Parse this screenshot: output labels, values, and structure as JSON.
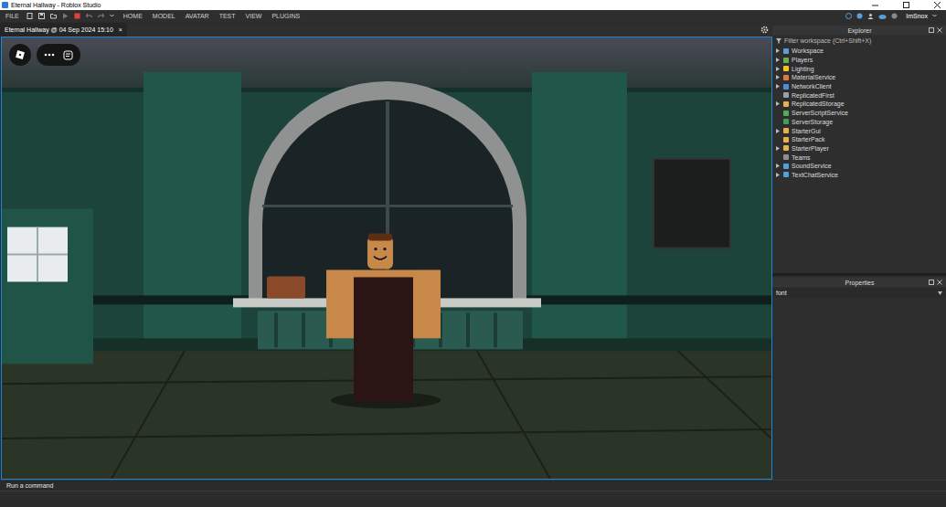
{
  "window": {
    "title": "Eternal Hallway - Roblox Studio"
  },
  "toolbar": {
    "file": "FILE",
    "menus": [
      "HOME",
      "MODEL",
      "AVATAR",
      "TEST",
      "VIEW",
      "PLUGINS"
    ],
    "user": "ImSnox"
  },
  "document_tabs": [
    {
      "label": "Eternal Hallway @ 04 Sep 2024 15:10",
      "close": "×",
      "selected": true
    }
  ],
  "explorer": {
    "title": "Explorer",
    "filter_placeholder": "Filter workspace (Ctrl+Shift+X)",
    "items": [
      {
        "name": "Workspace",
        "expandable": true,
        "color": "#5aa0d8"
      },
      {
        "name": "Players",
        "expandable": true,
        "color": "#6ab04c"
      },
      {
        "name": "Lighting",
        "expandable": true,
        "color": "#f0c419"
      },
      {
        "name": "MaterialService",
        "expandable": true,
        "color": "#e07a3c"
      },
      {
        "name": "NetworkClient",
        "expandable": true,
        "color": "#4a90d9"
      },
      {
        "name": "ReplicatedFirst",
        "expandable": false,
        "color": "#9aa0a6"
      },
      {
        "name": "ReplicatedStorage",
        "expandable": true,
        "color": "#e8b04a"
      },
      {
        "name": "ServerScriptService",
        "expandable": false,
        "color": "#4caf50"
      },
      {
        "name": "ServerStorage",
        "expandable": false,
        "color": "#3f9f5a"
      },
      {
        "name": "StarterGui",
        "expandable": true,
        "color": "#e8b04a"
      },
      {
        "name": "StarterPack",
        "expandable": false,
        "color": "#e8b04a"
      },
      {
        "name": "StarterPlayer",
        "expandable": true,
        "color": "#e8b04a"
      },
      {
        "name": "Teams",
        "expandable": false,
        "color": "#8e8e8e"
      },
      {
        "name": "SoundService",
        "expandable": true,
        "color": "#4aa3df"
      },
      {
        "name": "TextChatService",
        "expandable": true,
        "color": "#4aa3df"
      }
    ]
  },
  "properties": {
    "title": "Properties",
    "filter_value": "font"
  },
  "command_bar": {
    "placeholder": "Run a command"
  }
}
